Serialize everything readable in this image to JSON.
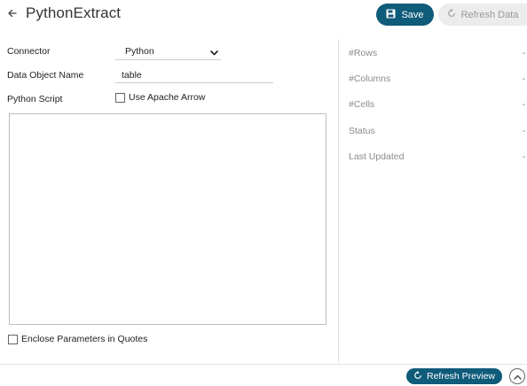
{
  "header": {
    "title": "PythonExtract",
    "save_label": "Save",
    "refresh_data_label": "Refresh Data"
  },
  "form": {
    "connector_label": "Connector",
    "connector_value": "Python",
    "data_object_label": "Data Object Name",
    "data_object_value": "table",
    "python_script_label": "Python Script",
    "use_apache_arrow_label": "Use Apache Arrow",
    "use_apache_arrow_checked": false,
    "script_value": "",
    "enclose_params_label": "Enclose Parameters in Quotes",
    "enclose_params_checked": false
  },
  "stats": {
    "rows_label": "#Rows",
    "rows_value": "-",
    "columns_label": "#Columns",
    "columns_value": "-",
    "cells_label": "#Cells",
    "cells_value": "-",
    "status_label": "Status",
    "status_value": "-",
    "last_updated_label": "Last Updated",
    "last_updated_value": "-"
  },
  "footer": {
    "refresh_preview_label": "Refresh Preview"
  },
  "colors": {
    "primary": "#0f5b7a",
    "disabled_bg": "#ececec",
    "disabled_text": "#9a9a9a",
    "divider": "#e2e2e2"
  },
  "icons": {
    "back": "back-arrow-icon",
    "save": "save-icon",
    "refresh": "refresh-icon",
    "dropdown": "chevron-down-icon",
    "collapse": "chevron-up-icon"
  }
}
